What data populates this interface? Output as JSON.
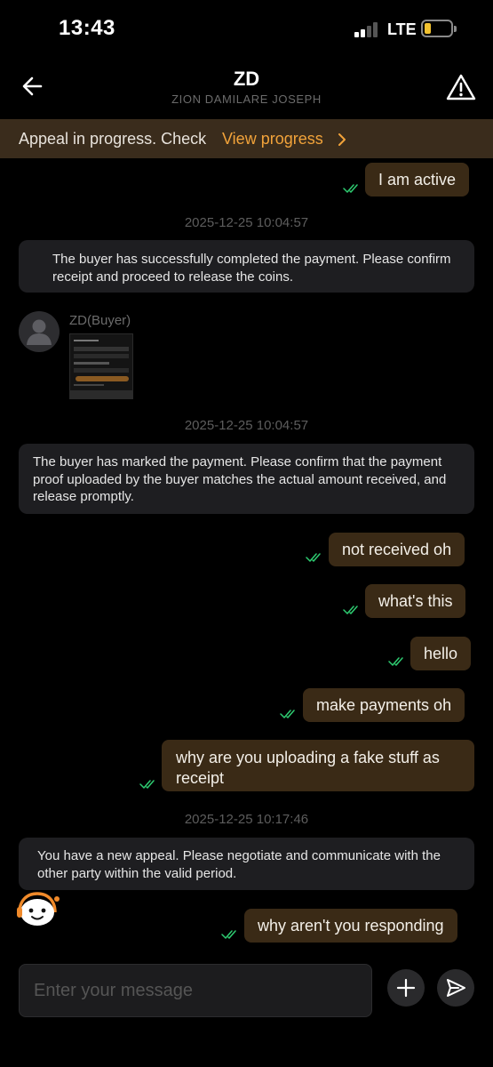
{
  "status_bar": {
    "time": "13:43",
    "network": "LTE",
    "battery_level": 0.2
  },
  "header": {
    "title": "ZD",
    "subtitle": "ZION DAMILARE JOSEPH",
    "back_icon": "arrow-left-icon",
    "report_icon": "warning-triangle-icon"
  },
  "banner": {
    "text": "Appeal in progress. Check",
    "link": "View progress"
  },
  "messages": {
    "m1": "I am active",
    "ts1": "2025-12-25 10:04:57",
    "sys1": "The buyer has successfully completed the payment. Please confirm receipt and proceed to release the coins.",
    "buyer_name": "ZD(Buyer)",
    "ts2": "2025-12-25 10:04:57",
    "sys2": "The buyer has marked the payment. Please confirm that the payment proof uploaded by the buyer matches the actual amount received, and release promptly.",
    "m2": "not received oh",
    "m3": "what's this",
    "m4": "hello",
    "m5": "make payments oh",
    "m6": "why are you uploading a fake stuff as receipt",
    "ts3": "2025-12-25 10:17:46",
    "sys3": "You have a new appeal. Please negotiate and communicate with the other party within the valid period.",
    "m7": "why aren't you responding"
  },
  "composer": {
    "placeholder": "Enter your message",
    "add_icon": "plus-icon",
    "send_icon": "send-icon"
  },
  "colors": {
    "accent": "#f2a33a",
    "bubble_out": "#3a2a16",
    "check": "#2ecc71",
    "banner_bg": "#3a2c1c"
  }
}
